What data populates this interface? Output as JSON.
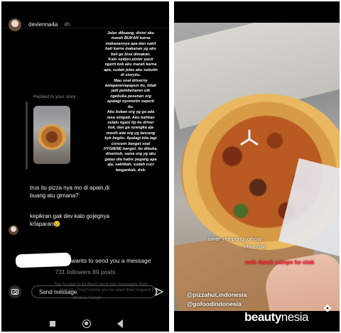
{
  "dm": {
    "username": "devienna4a",
    "time": "4h",
    "story_reply_text": "Jelas dibuang, disini aku\nmarah BUKAN karna\nmakanannya apa dan sakit\nhati karna makanan yg aku\nbeli ga bisa dimakan.\nKalo netijen pinter pasti\nngerti kok aku marah karna\napa, sudah jelas aku sebutin\ndi storyku.\nMau soal driverny\nkelaparan/apapun itu, tidak\njadi pembenaran utk\nngebuka pesenan org\napalagi nyomotin seperti\nitu.\nAku bukan org yg ga ada\nrasa simpati. Aku bahkan\nselalu ngasi tip ke driver\nkok, dan ga nyangka aja\nmasih ada org yg lancang\nkyk begitu. Apalagi kita lagi\nconcern banget soal\nHYGIENE banget, itu dibuka,\ndisentuh, sama org yg aku\ngatau dia habis pegang apa\naja, sakitkah, sudah cuci\ntangankah, dsb.",
    "replied_label": "Replied to your story",
    "message_1": "trus itu pizza nya mo di apain,di\nbuang atu gimana?",
    "message_2": "kepikran gak dev kalo gojegnya\nkrlaparan😢",
    "request_text": "wants to send you a message",
    "followers_text": "731 followers 89 posts",
    "faded_line_1": "Tap Accept to let them send you messages from",
    "faded_line_2": "now on. They'll know you've seen their request if you",
    "faded_accept": "choose Accept",
    "send_placeholder": "Send message"
  },
  "photo": {
    "watermark_user": "tante_rempong_official",
    "watermark_credit": "PhotoGrid",
    "red_caption": "naik darah sampe ke otak",
    "tag_1": "@pizzahut.indonesia",
    "tag_2": "@gofoodindonesia"
  },
  "brand": {
    "text_bold": "beauty",
    "text_regular": "nesia"
  },
  "icons": {
    "camera": "camera-icon",
    "send": "send-arrow-icon",
    "nav_recent": "square-icon",
    "nav_home": "circle-icon",
    "nav_back": "triangle-back-icon",
    "brand_flower": "flower-icon"
  },
  "colors": {
    "panel_bg": "#000000",
    "red_caption": "#ff2d3a",
    "faded_text": "#555555"
  }
}
